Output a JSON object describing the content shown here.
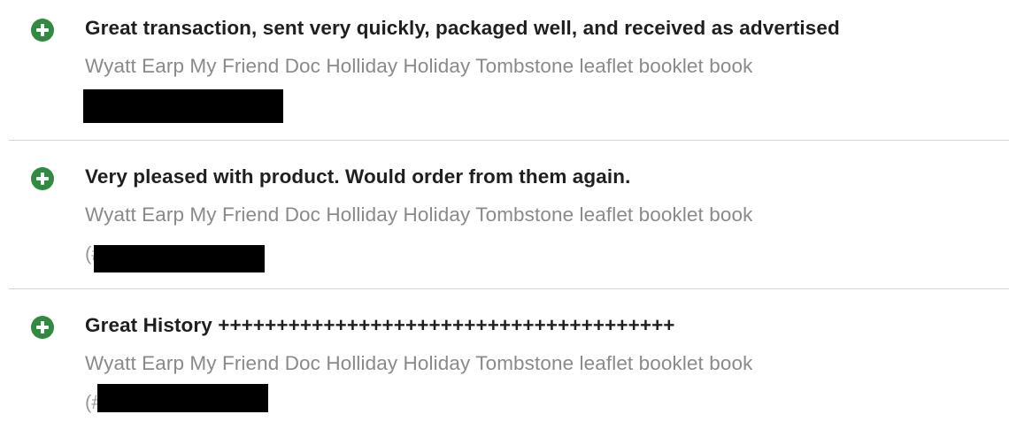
{
  "feedback": [
    {
      "rating": "positive",
      "rating_icon": "plus-circle-icon",
      "comment": "Great transaction, sent very quickly, packaged well, and received as advertised",
      "item_title": "Wyatt Earp My Friend Doc Holliday Holiday Tombstone leaflet booklet book",
      "item_number_prefix": "",
      "redacted": true
    },
    {
      "rating": "positive",
      "rating_icon": "plus-circle-icon",
      "comment": "Very pleased with product. Would order from them again.",
      "item_title": "Wyatt Earp My Friend Doc Holliday Holiday Tombstone leaflet booklet book",
      "item_number_prefix": "(#",
      "redacted": true
    },
    {
      "rating": "positive",
      "rating_icon": "plus-circle-icon",
      "comment": "Great History +++++++++++++++++++++++++++++++++++++++",
      "item_title": "Wyatt Earp My Friend Doc Holliday Holiday Tombstone leaflet booklet book",
      "item_number_prefix": "(#",
      "redacted": true
    }
  ],
  "colors": {
    "positive_icon": "#2e8b3f",
    "comment_text": "#1f1f1f",
    "item_text": "#8a8a8a",
    "divider": "#d6d6d6",
    "redaction": "#000000"
  }
}
